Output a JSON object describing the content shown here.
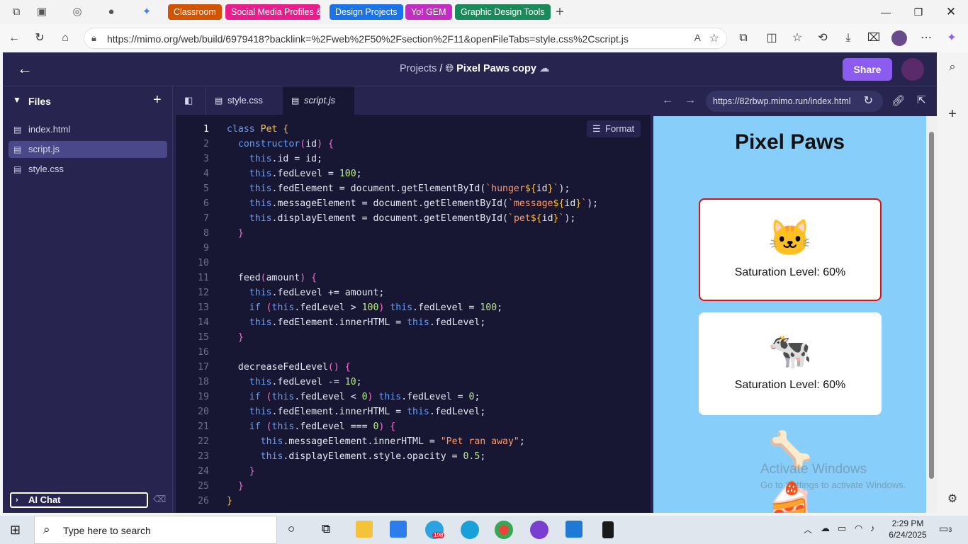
{
  "browser": {
    "tab_groups": [
      {
        "label": "Classroom",
        "color": "#d35400"
      },
      {
        "label": "Social Media Profiles &",
        "color": "#e91e8c"
      },
      {
        "label": "Design Projects",
        "color": "#1a73e8"
      },
      {
        "label": "Yo! GEM",
        "color": "#c22ec2"
      },
      {
        "label": "Graphic Design Tools",
        "color": "#1b8a5a"
      }
    ],
    "address": "https://mimo.org/web/build/6979418?backlink=%2Fweb%2F50%2Fsection%2F11&openFileTabs=style.css%2Cscript.js"
  },
  "app": {
    "breadcrumb_root": "Projects",
    "separator": "/",
    "project_name": "Pixel Paws copy",
    "share_label": "Share"
  },
  "files": {
    "header": "Files",
    "items": [
      {
        "name": "index.html",
        "icon": "html-file-icon"
      },
      {
        "name": "script.js",
        "icon": "js-file-icon"
      },
      {
        "name": "style.css",
        "icon": "css-file-icon"
      }
    ],
    "ai_chat": "AI Chat"
  },
  "editor": {
    "tabs": [
      {
        "label": "style.css"
      },
      {
        "label": "script.js"
      }
    ],
    "format_label": "Format",
    "line_numbers": [
      "1",
      "2",
      "3",
      "4",
      "5",
      "6",
      "7",
      "8",
      "9",
      "10",
      "11",
      "12",
      "13",
      "14",
      "15",
      "16",
      "17",
      "18",
      "19",
      "20",
      "21",
      "22",
      "23",
      "24",
      "25",
      "26"
    ],
    "lines": [
      [
        [
          "kw",
          "class "
        ],
        [
          "nm",
          "Pet "
        ],
        [
          "nm",
          "{"
        ]
      ],
      [
        [
          "fn",
          "  "
        ],
        [
          "kw",
          "constructor"
        ],
        [
          "br",
          "("
        ],
        [
          "fn",
          "id"
        ],
        [
          "br",
          ") {"
        ]
      ],
      [
        [
          "fn",
          "    "
        ],
        [
          "kw",
          "this"
        ],
        [
          "fn",
          ".id = id;"
        ]
      ],
      [
        [
          "fn",
          "    "
        ],
        [
          "kw",
          "this"
        ],
        [
          "fn",
          ".fedLevel = "
        ],
        [
          "num",
          "100"
        ],
        [
          "fn",
          ";"
        ]
      ],
      [
        [
          "fn",
          "    "
        ],
        [
          "kw",
          "this"
        ],
        [
          "fn",
          ".fedElement = document.getElementById("
        ],
        [
          "st",
          "`hunger"
        ],
        [
          "nm",
          "${"
        ],
        [
          "fn",
          "id"
        ],
        [
          "nm",
          "}"
        ],
        [
          "st",
          "`"
        ],
        [
          "fn",
          ");"
        ]
      ],
      [
        [
          "fn",
          "    "
        ],
        [
          "kw",
          "this"
        ],
        [
          "fn",
          ".messageElement = document.getElementById("
        ],
        [
          "st",
          "`message"
        ],
        [
          "nm",
          "${"
        ],
        [
          "fn",
          "id"
        ],
        [
          "nm",
          "}"
        ],
        [
          "st",
          "`"
        ],
        [
          "fn",
          ");"
        ]
      ],
      [
        [
          "fn",
          "    "
        ],
        [
          "kw",
          "this"
        ],
        [
          "fn",
          ".displayElement = document.getElementById("
        ],
        [
          "st",
          "`pet"
        ],
        [
          "nm",
          "${"
        ],
        [
          "fn",
          "id"
        ],
        [
          "nm",
          "}"
        ],
        [
          "st",
          "`"
        ],
        [
          "fn",
          ");"
        ]
      ],
      [
        [
          "fn",
          "  "
        ],
        [
          "br",
          "}"
        ]
      ],
      [],
      [],
      [
        [
          "fn",
          "  feed"
        ],
        [
          "br",
          "("
        ],
        [
          "fn",
          "amount"
        ],
        [
          "br",
          ") {"
        ]
      ],
      [
        [
          "fn",
          "    "
        ],
        [
          "kw",
          "this"
        ],
        [
          "fn",
          ".fedLevel += amount;"
        ]
      ],
      [
        [
          "fn",
          "    "
        ],
        [
          "kw",
          "if "
        ],
        [
          "br",
          "("
        ],
        [
          "kw",
          "this"
        ],
        [
          "fn",
          ".fedLevel > "
        ],
        [
          "num",
          "100"
        ],
        [
          "br",
          ") "
        ],
        [
          "kw",
          "this"
        ],
        [
          "fn",
          ".fedLevel = "
        ],
        [
          "num",
          "100"
        ],
        [
          "fn",
          ";"
        ]
      ],
      [
        [
          "fn",
          "    "
        ],
        [
          "kw",
          "this"
        ],
        [
          "fn",
          ".fedElement.innerHTML = "
        ],
        [
          "kw",
          "this"
        ],
        [
          "fn",
          ".fedLevel;"
        ]
      ],
      [
        [
          "fn",
          "  "
        ],
        [
          "br",
          "}"
        ]
      ],
      [],
      [
        [
          "fn",
          "  decreaseFedLevel"
        ],
        [
          "br",
          "() {"
        ]
      ],
      [
        [
          "fn",
          "    "
        ],
        [
          "kw",
          "this"
        ],
        [
          "fn",
          ".fedLevel -= "
        ],
        [
          "num",
          "10"
        ],
        [
          "fn",
          ";"
        ]
      ],
      [
        [
          "fn",
          "    "
        ],
        [
          "kw",
          "if "
        ],
        [
          "br",
          "("
        ],
        [
          "kw",
          "this"
        ],
        [
          "fn",
          ".fedLevel < "
        ],
        [
          "num",
          "0"
        ],
        [
          "br",
          ") "
        ],
        [
          "kw",
          "this"
        ],
        [
          "fn",
          ".fedLevel = "
        ],
        [
          "num",
          "0"
        ],
        [
          "fn",
          ";"
        ]
      ],
      [
        [
          "fn",
          "    "
        ],
        [
          "kw",
          "this"
        ],
        [
          "fn",
          ".fedElement.innerHTML = "
        ],
        [
          "kw",
          "this"
        ],
        [
          "fn",
          ".fedLevel;"
        ]
      ],
      [
        [
          "fn",
          "    "
        ],
        [
          "kw",
          "if "
        ],
        [
          "br",
          "("
        ],
        [
          "kw",
          "this"
        ],
        [
          "fn",
          ".fedLevel === "
        ],
        [
          "num",
          "0"
        ],
        [
          "br",
          ") {"
        ]
      ],
      [
        [
          "fn",
          "      "
        ],
        [
          "kw",
          "this"
        ],
        [
          "fn",
          ".messageElement.innerHTML = "
        ],
        [
          "st",
          "\"Pet ran away\""
        ],
        [
          "fn",
          ";"
        ]
      ],
      [
        [
          "fn",
          "      "
        ],
        [
          "kw",
          "this"
        ],
        [
          "fn",
          ".displayElement.style.opacity = "
        ],
        [
          "num",
          "0.5"
        ],
        [
          "fn",
          ";"
        ]
      ],
      [
        [
          "fn",
          "    "
        ],
        [
          "br",
          "}"
        ]
      ],
      [
        [
          "fn",
          "  "
        ],
        [
          "br",
          "}"
        ]
      ],
      [
        [
          "nm",
          "}"
        ]
      ]
    ]
  },
  "preview": {
    "url": "https://82rbwp.mimo.run/index.html",
    "title": "Pixel Paws",
    "cards": [
      {
        "emoji": "🐱",
        "text": "Saturation Level: 60%",
        "selected": true
      },
      {
        "emoji": "🐄",
        "text": "Saturation Level: 60%",
        "selected": false
      }
    ],
    "bone": "🦴",
    "cake": "🍰",
    "watermark_title": "Activate Windows",
    "watermark_sub": "Go to Settings to activate Windows."
  },
  "taskbar": {
    "search_placeholder": "Type here to search",
    "telegram_badge": "198",
    "time": "2:29 PM",
    "date": "6/24/2025",
    "notification_count": "3"
  }
}
